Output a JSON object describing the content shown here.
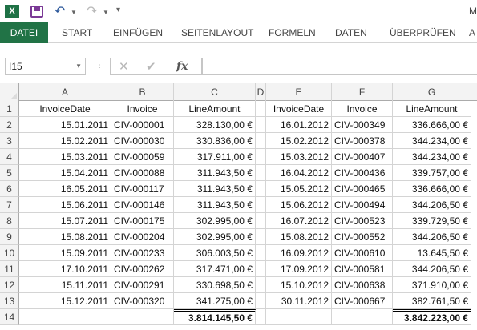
{
  "app": {
    "logo": "X",
    "title_fragment": "M"
  },
  "ribbon_tabs": [
    "DATEI",
    "START",
    "EINFÜGEN",
    "SEITENLAYOUT",
    "FORMELN",
    "DATEN",
    "ÜBERPRÜFEN",
    "A"
  ],
  "formula_bar": {
    "name_box": "I15",
    "fx": "fx",
    "formula": ""
  },
  "columns": [
    "A",
    "B",
    "C",
    "D",
    "E",
    "F",
    "G"
  ],
  "rows": [
    [
      "InvoiceDate",
      "Invoice",
      "LineAmount",
      "",
      "InvoiceDate",
      "Invoice",
      "LineAmount"
    ],
    [
      "15.01.2011",
      "CIV-000001",
      "328.130,00 €",
      "",
      "16.01.2012",
      "CIV-000349",
      "336.666,00 €"
    ],
    [
      "15.02.2011",
      "CIV-000030",
      "330.836,00 €",
      "",
      "15.02.2012",
      "CIV-000378",
      "344.234,00 €"
    ],
    [
      "15.03.2011",
      "CIV-000059",
      "317.911,00 €",
      "",
      "15.03.2012",
      "CIV-000407",
      "344.234,00 €"
    ],
    [
      "15.04.2011",
      "CIV-000088",
      "311.943,50 €",
      "",
      "16.04.2012",
      "CIV-000436",
      "339.757,00 €"
    ],
    [
      "16.05.2011",
      "CIV-000117",
      "311.943,50 €",
      "",
      "15.05.2012",
      "CIV-000465",
      "336.666,00 €"
    ],
    [
      "15.06.2011",
      "CIV-000146",
      "311.943,50 €",
      "",
      "15.06.2012",
      "CIV-000494",
      "344.206,50 €"
    ],
    [
      "15.07.2011",
      "CIV-000175",
      "302.995,00 €",
      "",
      "16.07.2012",
      "CIV-000523",
      "339.729,50 €"
    ],
    [
      "15.08.2011",
      "CIV-000204",
      "302.995,00 €",
      "",
      "15.08.2012",
      "CIV-000552",
      "344.206,50 €"
    ],
    [
      "15.09.2011",
      "CIV-000233",
      "306.003,50 €",
      "",
      "16.09.2012",
      "CIV-000610",
      "13.645,50 €"
    ],
    [
      "17.10.2011",
      "CIV-000262",
      "317.471,00 €",
      "",
      "17.09.2012",
      "CIV-000581",
      "344.206,50 €"
    ],
    [
      "15.11.2011",
      "CIV-000291",
      "330.698,50 €",
      "",
      "15.10.2012",
      "CIV-000638",
      "371.910,00 €"
    ],
    [
      "15.12.2011",
      "CIV-000320",
      "341.275,00 €",
      "",
      "30.11.2012",
      "CIV-000667",
      "382.761,50 €"
    ],
    [
      "",
      "",
      "3.814.145,50 €",
      "",
      "",
      "",
      "3.842.223,00 €"
    ]
  ],
  "colors": {
    "file_tab": "#217346",
    "logo": "#1e7145",
    "save_icon": "#7b3a96",
    "undo_icon": "#2b579a"
  }
}
